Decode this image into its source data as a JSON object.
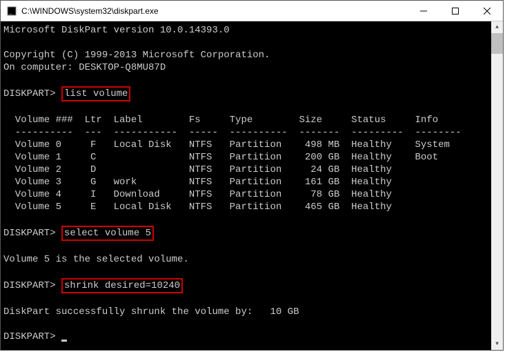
{
  "window": {
    "title": "C:\\WINDOWS\\system32\\diskpart.exe"
  },
  "version_line": "Microsoft DiskPart version 10.0.14393.0",
  "copyright_line": "Copyright (C) 1999-2013 Microsoft Corporation.",
  "computer_line": "On computer: DESKTOP-Q8MU87D",
  "prompt": "DISKPART>",
  "cmd1": "list volume",
  "table": {
    "headers": {
      "volume": "Volume ###",
      "ltr": "Ltr",
      "label": "Label",
      "fs": "Fs",
      "type": "Type",
      "size": "Size",
      "status": "Status",
      "info": "Info"
    },
    "dashes": {
      "volume": "----------",
      "ltr": "---",
      "label": "-----------",
      "fs": "-----",
      "type": "----------",
      "size": "-------",
      "status": "---------",
      "info": "--------"
    },
    "rows": [
      {
        "vol": "Volume 0",
        "ltr": "F",
        "label": "Local Disk",
        "fs": "NTFS",
        "type": "Partition",
        "size": "498 MB",
        "status": "Healthy",
        "info": "System"
      },
      {
        "vol": "Volume 1",
        "ltr": "C",
        "label": "",
        "fs": "NTFS",
        "type": "Partition",
        "size": "200 GB",
        "status": "Healthy",
        "info": "Boot"
      },
      {
        "vol": "Volume 2",
        "ltr": "D",
        "label": "",
        "fs": "NTFS",
        "type": "Partition",
        "size": "24 GB",
        "status": "Healthy",
        "info": ""
      },
      {
        "vol": "Volume 3",
        "ltr": "G",
        "label": "work",
        "fs": "NTFS",
        "type": "Partition",
        "size": "161 GB",
        "status": "Healthy",
        "info": ""
      },
      {
        "vol": "Volume 4",
        "ltr": "I",
        "label": "Download",
        "fs": "NTFS",
        "type": "Partition",
        "size": "78 GB",
        "status": "Healthy",
        "info": ""
      },
      {
        "vol": "Volume 5",
        "ltr": "E",
        "label": "Local Disk",
        "fs": "NTFS",
        "type": "Partition",
        "size": "465 GB",
        "status": "Healthy",
        "info": ""
      }
    ]
  },
  "cmd2": "select volume 5",
  "sel_confirm": "Volume 5 is the selected volume.",
  "cmd3": "shrink desired=10240",
  "shrink_confirm": "DiskPart successfully shrunk the volume by:   10 GB",
  "chart_data": {
    "type": "table",
    "title": "DiskPart volume list",
    "columns": [
      "Volume ###",
      "Ltr",
      "Label",
      "Fs",
      "Type",
      "Size",
      "Status",
      "Info"
    ],
    "rows": [
      [
        "Volume 0",
        "F",
        "Local Disk",
        "NTFS",
        "Partition",
        "498 MB",
        "Healthy",
        "System"
      ],
      [
        "Volume 1",
        "C",
        "",
        "NTFS",
        "Partition",
        "200 GB",
        "Healthy",
        "Boot"
      ],
      [
        "Volume 2",
        "D",
        "",
        "NTFS",
        "Partition",
        "24 GB",
        "Healthy",
        ""
      ],
      [
        "Volume 3",
        "G",
        "work",
        "NTFS",
        "Partition",
        "161 GB",
        "Healthy",
        ""
      ],
      [
        "Volume 4",
        "I",
        "Download",
        "NTFS",
        "Partition",
        "78 GB",
        "Healthy",
        ""
      ],
      [
        "Volume 5",
        "E",
        "Local Disk",
        "NTFS",
        "Partition",
        "465 GB",
        "Healthy",
        ""
      ]
    ]
  }
}
